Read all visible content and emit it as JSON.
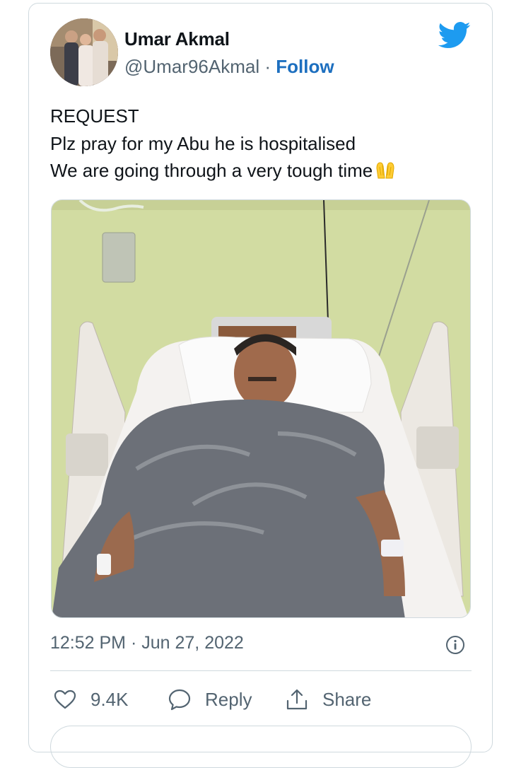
{
  "tweet": {
    "author_name": "Umar Akmal",
    "handle": "@Umar96Akmal",
    "separator": "·",
    "follow_label": "Follow",
    "lines": [
      "REQUEST",
      "Plz pray for my Abu he is hospitalised",
      "We are going through a very tough time"
    ],
    "emoji": "folded-hands-icon",
    "time": "12:52 PM",
    "date": "Jun 27, 2022",
    "likes": "9.4K",
    "reply_label": "Reply",
    "share_label": "Share"
  },
  "colors": {
    "brand": "#1d9bf0",
    "follow": "#1d6fbf",
    "muted": "#536471",
    "border": "#cfd9de"
  },
  "icons": [
    "twitter-bird-icon",
    "info-icon",
    "heart-icon",
    "reply-bubble-icon",
    "share-icon"
  ]
}
